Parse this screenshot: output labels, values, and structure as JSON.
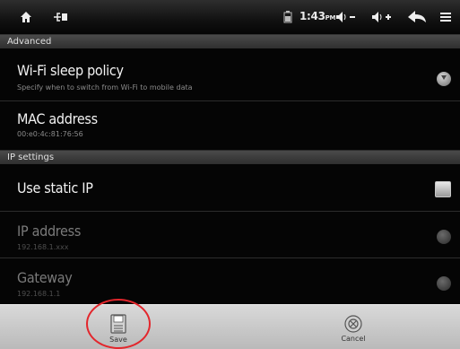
{
  "status_bar": {
    "time": "1:43",
    "time_suffix": "PM",
    "icons": [
      "home-icon",
      "usb-icon",
      "battery-icon",
      "volume-down-icon",
      "volume-up-icon",
      "back-icon",
      "menu-icon"
    ]
  },
  "sections": {
    "advanced": {
      "label": "Advanced"
    },
    "ip_settings": {
      "label": "IP settings"
    }
  },
  "wifi_sleep_policy": {
    "title": "Wi-Fi sleep policy",
    "summary": "Specify when to switch from Wi-Fi to mobile data"
  },
  "mac_address": {
    "title": "MAC address",
    "value": "00:e0:4c:81:76:56"
  },
  "use_static_ip": {
    "title": "Use static IP",
    "checked": false
  },
  "ip_address": {
    "title": "IP address",
    "value": "192.168.1.xxx"
  },
  "gateway": {
    "title": "Gateway",
    "value": "192.168.1.1"
  },
  "bottom_bar": {
    "save_label": "Save",
    "cancel_label": "Cancel"
  },
  "colors": {
    "annotation_circle": "#e3262c",
    "background": "#050505",
    "bottom_bar": "#c9c9c9"
  }
}
